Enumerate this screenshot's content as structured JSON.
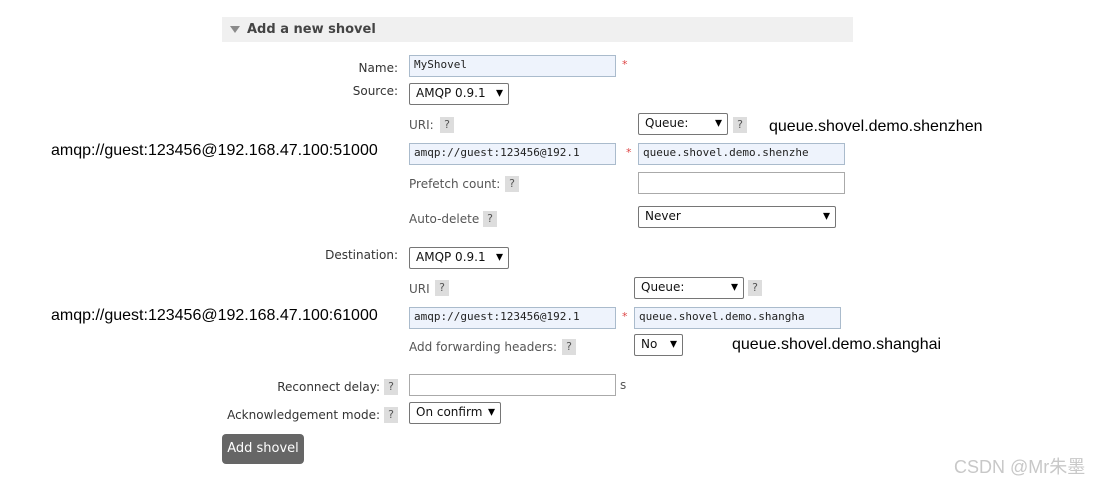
{
  "section": {
    "title": "Add a new shovel"
  },
  "name": {
    "label": "Name:",
    "value": "MyShovel",
    "required": "*"
  },
  "source": {
    "label": "Source:",
    "protocol": "AMQP 0.9.1",
    "uri_label": "URI:",
    "uri_value": "amqp://guest:123456@192.1",
    "uri_required": "*",
    "type": "Queue:",
    "queue_value": "queue.shovel.demo.shenzhe",
    "prefetch_label": "Prefetch count:",
    "prefetch_value": "",
    "autodelete_label": "Auto-delete",
    "autodelete_value": "Never",
    "annotation_uri": "amqp://guest:123456@192.168.47.100:51000",
    "annotation_queue": "queue.shovel.demo.shenzhen"
  },
  "destination": {
    "label": "Destination:",
    "protocol": "AMQP 0.9.1",
    "uri_label": "URI",
    "uri_value": "amqp://guest:123456@192.1",
    "uri_required": "*",
    "type": "Queue:",
    "queue_value": "queue.shovel.demo.shangha",
    "headers_label": "Add forwarding headers:",
    "headers_value": "No",
    "annotation_uri": "amqp://guest:123456@192.168.47.100:61000",
    "annotation_queue": "queue.shovel.demo.shanghai"
  },
  "reconnect": {
    "label": "Reconnect delay:",
    "value": "",
    "unit": "s"
  },
  "ack": {
    "label": "Acknowledgement mode:",
    "value": "On confirm"
  },
  "help_mark": "?",
  "submit_label": "Add shovel",
  "watermark": "CSDN @Mr朱墨"
}
